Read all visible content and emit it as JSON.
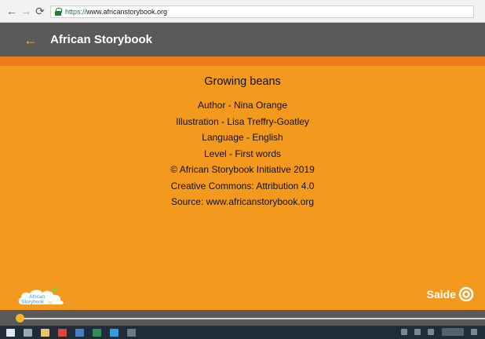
{
  "browser": {
    "back_icon": "arrow-left-icon",
    "forward_icon": "arrow-right-icon",
    "reload_icon": "reload-icon",
    "url_scheme": "https://",
    "url_host": "www.africanstorybook.org"
  },
  "header": {
    "back_icon": "arrow-left-icon",
    "title": "African Storybook",
    "accent_color": "#f7b42c",
    "background_color": "#5a5a5a"
  },
  "page": {
    "background_color": "#f3991d",
    "story_title": "Growing beans",
    "credits": {
      "author": "Author - Nina Orange",
      "illustration": "Illustration - Lisa Treffry-Goatley",
      "language": "Language - English",
      "level": "Level - First words",
      "copyright": "© African Storybook Initiative 2019",
      "license": "Creative Commons: Attribution 4.0",
      "source": "Source: www.africanstorybook.org"
    }
  },
  "logos": {
    "asb_line1": "African",
    "asb_line2": "Storybook",
    "asb_suffix": ".org",
    "saide": "Saide"
  },
  "progress": {
    "fraction": 0.0
  }
}
